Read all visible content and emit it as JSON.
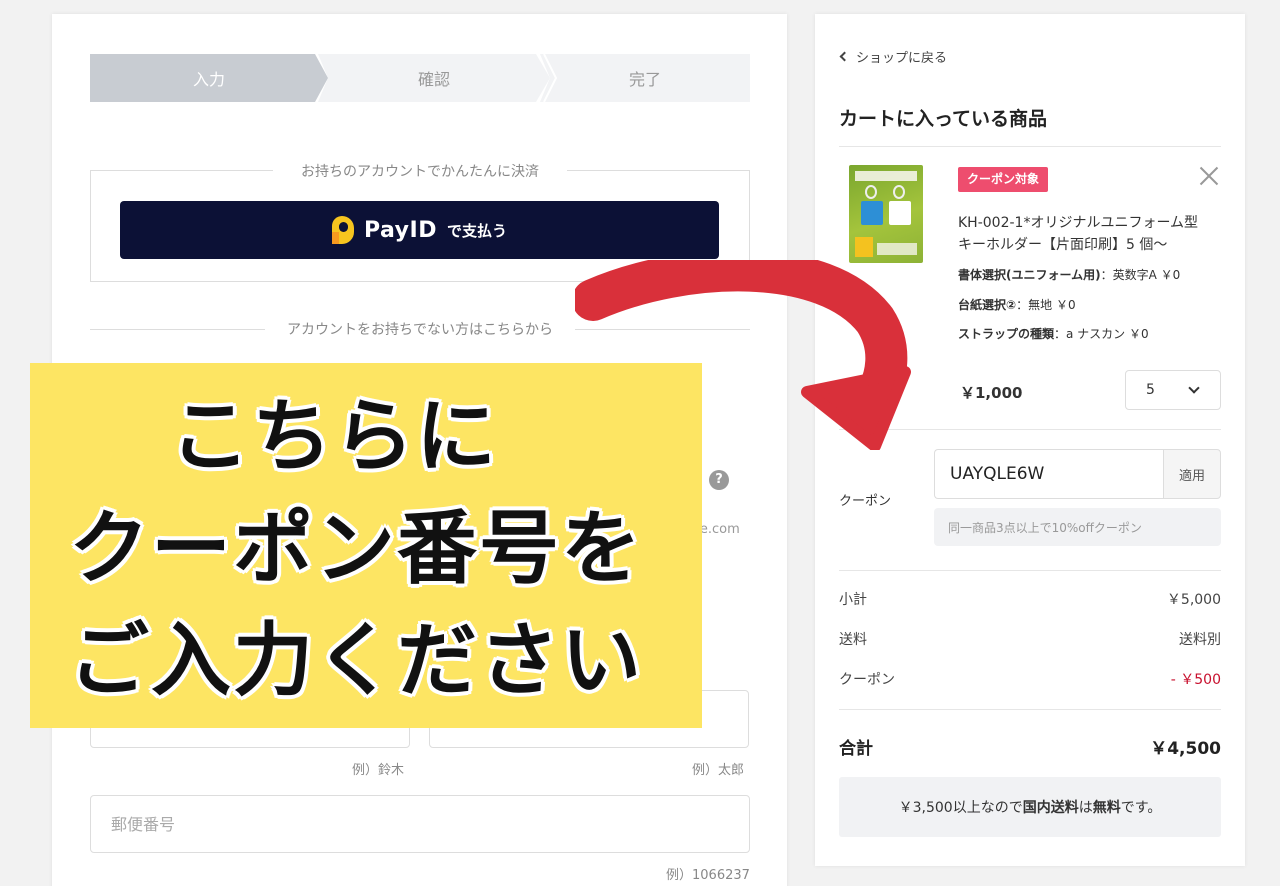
{
  "steps": [
    "入力",
    "確認",
    "完了"
  ],
  "account_section": {
    "legend": "お持ちのアカウントでかんたんに決済",
    "payid_brand": "PayID",
    "payid_suffix": "で支払う"
  },
  "guest_section": {
    "divider": "アカウントをお持ちでない方はこちらから",
    "help_glyph": "?",
    "email_hint_tail": "ple.com",
    "last_name_hint": "例）鈴木",
    "first_name_hint": "例）太郎",
    "postal_placeholder": "郵便番号",
    "postal_hint": "例）1066237"
  },
  "overlay": {
    "line1": "こちらに",
    "line2": "クーポン番号を",
    "line3": "ご入力ください"
  },
  "cart": {
    "back_link": "ショップに戻る",
    "title": "カートに入っている商品",
    "item": {
      "tag": "クーポン対象",
      "name": "KH-002-1*オリジナルユニフォーム型キーホルダー【片面印刷】5 個～",
      "options": [
        {
          "label": "書体選択(ユニフォーム用)",
          "value": "：英数字A ￥0"
        },
        {
          "label": "台紙選択②",
          "value": "：無地 ￥0"
        },
        {
          "label": "ストラップの種類",
          "value": "：a ナスカン ￥0"
        }
      ],
      "price": "￥1,000",
      "quantity": "5"
    },
    "coupon": {
      "label": "クーポン",
      "code": "UAYQLE6W",
      "apply": "適用",
      "note": "同一商品3点以上で10%offクーポン"
    },
    "summary": {
      "subtotal_label": "小計",
      "subtotal": "￥5,000",
      "shipping_label": "送料",
      "shipping": "送料別",
      "coupon_label": "クーポン",
      "coupon": "- ￥500",
      "total_label": "合計",
      "total": "￥4,500"
    },
    "free_shipping": {
      "pre": "￥3,500以上なので",
      "strong1": "国内送料",
      "mid": "は",
      "strong2": "無料",
      "post": "です。"
    }
  },
  "colors": {
    "overlay_bg": "#fde563",
    "arrow": "#d9303a",
    "coupon_tag": "#ee4d6e",
    "payid_bg": "#0c1136"
  }
}
